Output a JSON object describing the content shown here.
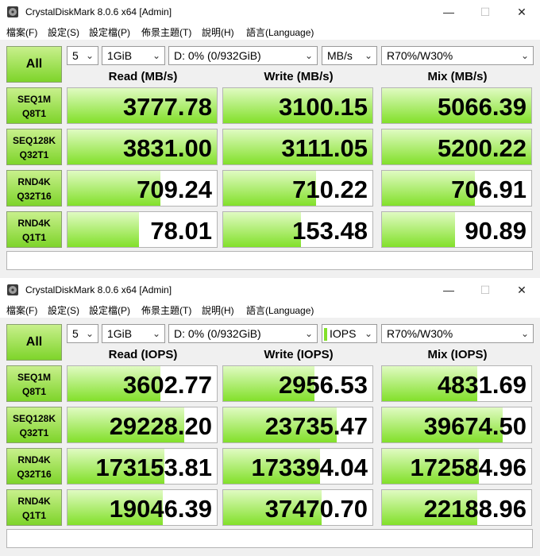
{
  "windows": [
    {
      "title": "CrystalDiskMark 8.0.6 x64 [Admin]",
      "menu": [
        "檔案(F)",
        "設定(S)",
        "設定檔(P)",
        "佈景主題(T)",
        "說明(H)",
        "語言(Language)"
      ],
      "all_label": "All",
      "controls": {
        "count": "5",
        "size": "1GiB",
        "drive": "D: 0% (0/932GiB)",
        "unit": "MB/s",
        "mix": "R70%/W30%"
      },
      "headers": [
        "Read (MB/s)",
        "Write (MB/s)",
        "Mix (MB/s)"
      ],
      "rows": [
        {
          "l1": "SEQ1M",
          "l2": "Q8T1",
          "values": [
            "3777.78",
            "3100.15",
            "5066.39"
          ],
          "fill": [
            1.0,
            1.0,
            1.0
          ]
        },
        {
          "l1": "SEQ128K",
          "l2": "Q32T1",
          "values": [
            "3831.00",
            "3111.05",
            "5200.22"
          ],
          "fill": [
            1.0,
            1.0,
            1.0
          ]
        },
        {
          "l1": "RND4K",
          "l2": "Q32T16",
          "values": [
            "709.24",
            "710.22",
            "706.91"
          ],
          "fill": [
            0.62,
            0.62,
            0.62
          ]
        },
        {
          "l1": "RND4K",
          "l2": "Q1T1",
          "values": [
            "78.01",
            "153.48",
            "90.89"
          ],
          "fill": [
            0.48,
            0.52,
            0.49
          ]
        }
      ],
      "colors": {
        "accent": "#82e02a",
        "accent_light": "#e0fbc2"
      }
    },
    {
      "title": "CrystalDiskMark 8.0.6 x64 [Admin]",
      "menu": [
        "檔案(F)",
        "設定(S)",
        "設定檔(P)",
        "佈景主題(T)",
        "說明(H)",
        "語言(Language)"
      ],
      "all_label": "All",
      "controls": {
        "count": "5",
        "size": "1GiB",
        "drive": "D: 0% (0/932GiB)",
        "unit": "IOPS",
        "mix": "R70%/W30%"
      },
      "headers": [
        "Read (IOPS)",
        "Write (IOPS)",
        "Mix (IOPS)"
      ],
      "rows": [
        {
          "l1": "SEQ1M",
          "l2": "Q8T1",
          "values": [
            "3602.77",
            "2956.53",
            "4831.69"
          ],
          "fill": [
            0.62,
            0.61,
            0.64
          ]
        },
        {
          "l1": "SEQ128K",
          "l2": "Q32T1",
          "values": [
            "29228.20",
            "23735.47",
            "39674.50"
          ],
          "fill": [
            0.78,
            0.76,
            0.81
          ]
        },
        {
          "l1": "RND4K",
          "l2": "Q32T16",
          "values": [
            "173153.81",
            "173394.04",
            "172584.96"
          ],
          "fill": [
            0.65,
            0.65,
            0.65
          ]
        },
        {
          "l1": "RND4K",
          "l2": "Q1T1",
          "values": [
            "19046.39",
            "37470.70",
            "22188.96"
          ],
          "fill": [
            0.64,
            0.66,
            0.64
          ]
        }
      ],
      "colors": {
        "accent": "#82e02a",
        "accent_light": "#e0fbc2"
      }
    }
  ]
}
